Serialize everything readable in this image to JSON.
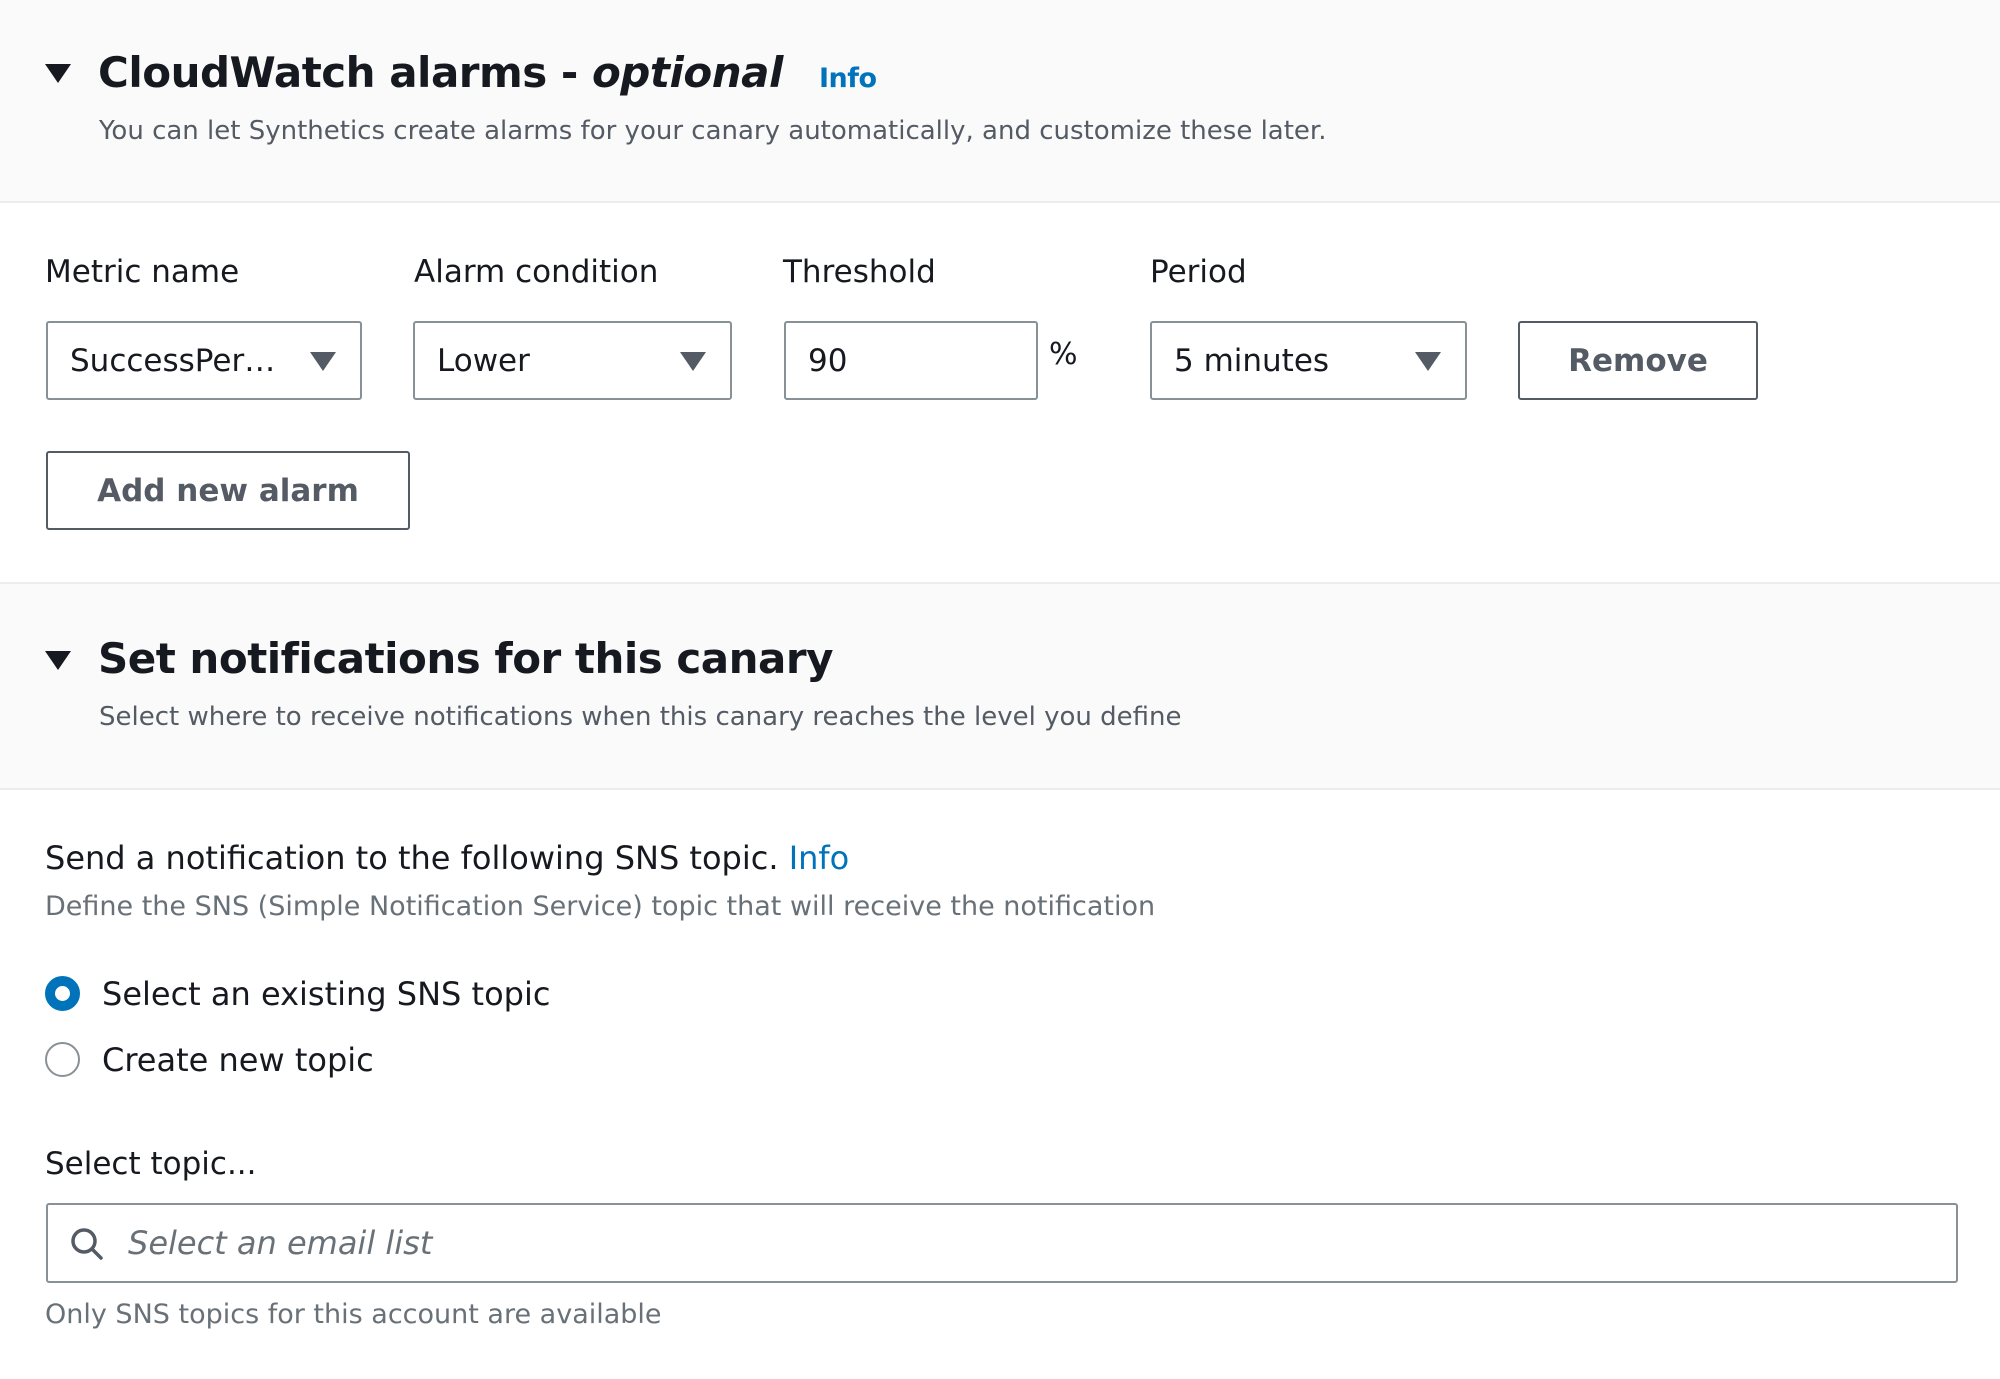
{
  "alarms_section": {
    "title": "CloudWatch alarms - ",
    "title_optional": "optional",
    "info_link": "Info",
    "description": "You can let Synthetics create alarms for your canary automatically, and customize these later.",
    "columns": {
      "metric_name": "Metric name",
      "alarm_condition": "Alarm condition",
      "threshold": "Threshold",
      "period": "Period"
    },
    "alarm_rows": [
      {
        "metric_name": "SuccessPer…",
        "alarm_condition": "Lower",
        "threshold": "90",
        "threshold_unit": "%",
        "period": "5 minutes",
        "remove_label": "Remove"
      }
    ],
    "add_alarm_label": "Add new alarm"
  },
  "notifications_section": {
    "title": "Set notifications for this canary",
    "description": "Select where to receive notifications when this canary reaches the level you define",
    "sns_label": "Send a notification to the following SNS topic.",
    "sns_info_link": "Info",
    "sns_description": "Define the SNS (Simple Notification Service) topic that will receive the notification",
    "radio_options": [
      {
        "label": "Select an existing SNS topic",
        "selected": true
      },
      {
        "label": "Create new topic",
        "selected": false
      }
    ],
    "topic_label": "Select topic...",
    "topic_placeholder": "Select an email list",
    "topic_hint": "Only SNS topics for this account are available"
  },
  "colors": {
    "accent": "#0073bb",
    "header_bg": "#fafafa",
    "border": "#879196",
    "text": "#16191f",
    "secondary_text": "#545b64"
  }
}
